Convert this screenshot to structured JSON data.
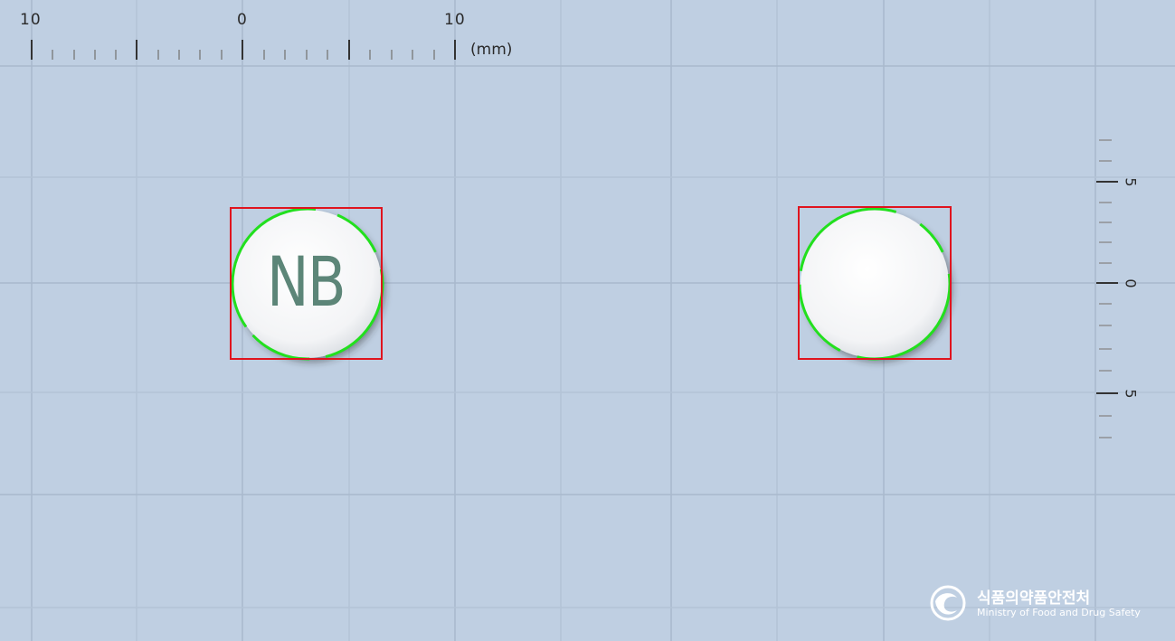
{
  "ruler_horizontal": {
    "labels": [
      "10",
      "0",
      "10"
    ],
    "unit": "(mm)"
  },
  "ruler_vertical": {
    "labels": [
      "5",
      "0",
      "5"
    ]
  },
  "pills": [
    {
      "side": "front",
      "imprint": "NB",
      "color": "white",
      "shape": "round"
    },
    {
      "side": "back",
      "imprint": "",
      "color": "white",
      "shape": "round"
    }
  ],
  "colors": {
    "background": "#bfcfe2",
    "grid": "#a8b8cc",
    "bounding_box": "#e0141e",
    "contour": "#22e01e",
    "imprint": "#4f7c6d"
  },
  "logo": {
    "korean": "식품의약품안전처",
    "english": "Ministry of Food and Drug Safety",
    "icon": "mfds-emblem-icon"
  }
}
